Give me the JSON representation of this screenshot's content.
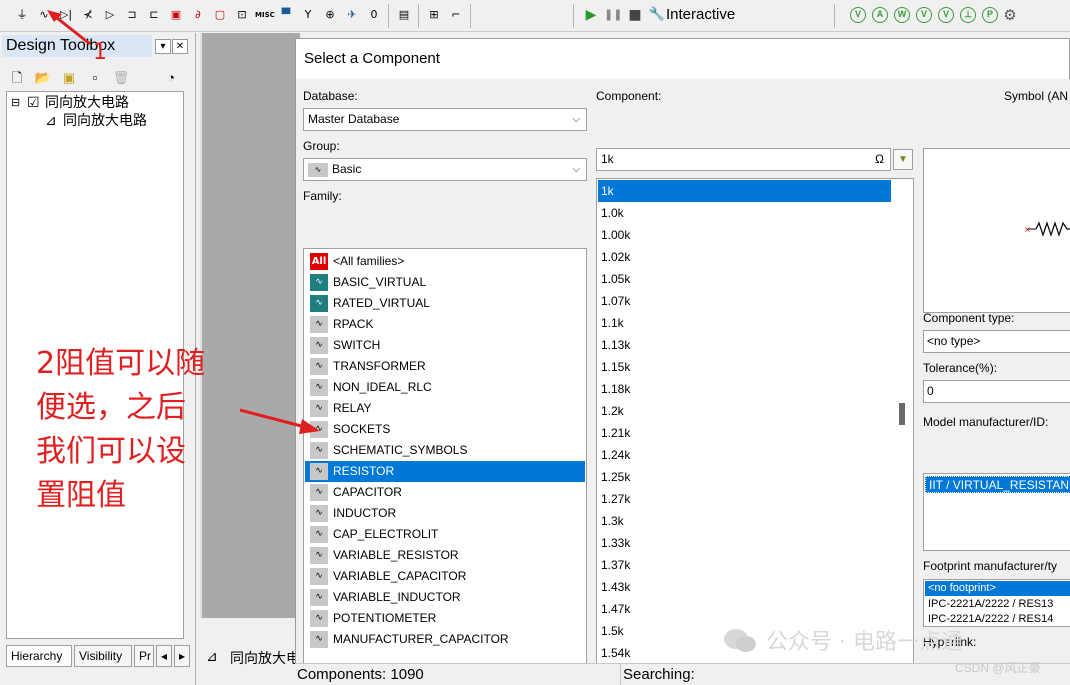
{
  "toolbar": {
    "interactive_label": "Interactive",
    "tool_icons": [
      "ground-icon",
      "resistor-icon",
      "diode-icon",
      "transistor-icon",
      "analog-icon",
      "ttl-icon",
      "cmos-icon",
      "mcu-icon",
      "advanced-peripherals-icon",
      "mixed-icon",
      "indicator-icon",
      "power-icon",
      "misc-icon",
      "rf-icon",
      "electromechanical-icon",
      "ni-icon",
      "connector-icon",
      "mcu-module-icon",
      "hierarchical-block-icon",
      "bus-icon"
    ],
    "misc_label": "MISC",
    "analysis_icons": [
      "probe-icon",
      "probe-a-icon",
      "probe-w-icon",
      "probe-vi-icon",
      "probe-v-icon",
      "probe-ref-icon",
      "probe-settings-icon"
    ]
  },
  "toolbox": {
    "title": "Design Toolbox",
    "tree_root": "同向放大电路",
    "tree_child": "同向放大电路",
    "tabs": [
      "Hierarchy",
      "Visibility",
      "Pr"
    ]
  },
  "workspace": {
    "sheet_tab": "同向放大电路"
  },
  "dialog": {
    "title": "Select a Component",
    "database_label": "Database:",
    "database_value": "Master Database",
    "group_label": "Group:",
    "group_value": "Basic",
    "family_label": "Family:",
    "families": [
      {
        "label": "<All families>",
        "icon": "all-families-icon",
        "selected": false
      },
      {
        "label": "BASIC_VIRTUAL",
        "icon": "basic-virtual-icon",
        "selected": false
      },
      {
        "label": "RATED_VIRTUAL",
        "icon": "rated-virtual-icon",
        "selected": false
      },
      {
        "label": "RPACK",
        "icon": "rpack-icon",
        "selected": false
      },
      {
        "label": "SWITCH",
        "icon": "switch-icon",
        "selected": false
      },
      {
        "label": "TRANSFORMER",
        "icon": "transformer-icon",
        "selected": false
      },
      {
        "label": "NON_IDEAL_RLC",
        "icon": "non-ideal-rlc-icon",
        "selected": false
      },
      {
        "label": "RELAY",
        "icon": "relay-icon",
        "selected": false
      },
      {
        "label": "SOCKETS",
        "icon": "sockets-icon",
        "selected": false
      },
      {
        "label": "SCHEMATIC_SYMBOLS",
        "icon": "schematic-symbols-icon",
        "selected": false
      },
      {
        "label": "RESISTOR",
        "icon": "resistor-icon",
        "selected": true
      },
      {
        "label": "CAPACITOR",
        "icon": "capacitor-icon",
        "selected": false
      },
      {
        "label": "INDUCTOR",
        "icon": "inductor-icon",
        "selected": false
      },
      {
        "label": "CAP_ELECTROLIT",
        "icon": "cap-electrolit-icon",
        "selected": false
      },
      {
        "label": "VARIABLE_RESISTOR",
        "icon": "variable-resistor-icon",
        "selected": false
      },
      {
        "label": "VARIABLE_CAPACITOR",
        "icon": "variable-capacitor-icon",
        "selected": false
      },
      {
        "label": "VARIABLE_INDUCTOR",
        "icon": "variable-inductor-icon",
        "selected": false
      },
      {
        "label": "POTENTIOMETER",
        "icon": "potentiometer-icon",
        "selected": false
      },
      {
        "label": "MANUFACTURER_CAPACITOR",
        "icon": "manufacturer-capacitor-icon",
        "selected": false
      }
    ],
    "component_label": "Component:",
    "component_value": "1k",
    "components": [
      "1k",
      "1.0k",
      "1.00k",
      "1.02k",
      "1.05k",
      "1.07k",
      "1.1k",
      "1.13k",
      "1.15k",
      "1.18k",
      "1.2k",
      "1.21k",
      "1.24k",
      "1.25k",
      "1.27k",
      "1.3k",
      "1.33k",
      "1.37k",
      "1.43k",
      "1.47k",
      "1.5k",
      "1.54k"
    ],
    "selected_component": "1k",
    "symbol_label": "Symbol (AN",
    "component_type_label": "Component type:",
    "component_type_value": "<no type>",
    "tolerance_label": "Tolerance(%):",
    "tolerance_value": "0",
    "model_label": "Model manufacturer/ID:",
    "model_value": "IIT / VIRTUAL_RESISTAN",
    "footprint_label": "Footprint manufacturer/ty",
    "footprints": [
      "<no footprint>",
      "IPC-2221A/2222 / RES13",
      "IPC-2221A/2222 / RES14"
    ],
    "hyperlink_label": "Hyperlink:",
    "status_components": "Components: 1090",
    "status_searching": "Searching:"
  },
  "annotations": {
    "arrow_number": "1",
    "note": "2阻值可以随便选，之后我们可以设置阻值",
    "note_color": "#e02020"
  },
  "watermark": {
    "main": "公众号 · 电路一点通",
    "credit": "CSDN @风正豪"
  },
  "colors": {
    "selection": "#0078d7",
    "workspace": "#a9a9a9",
    "annotation": "#e02020"
  }
}
